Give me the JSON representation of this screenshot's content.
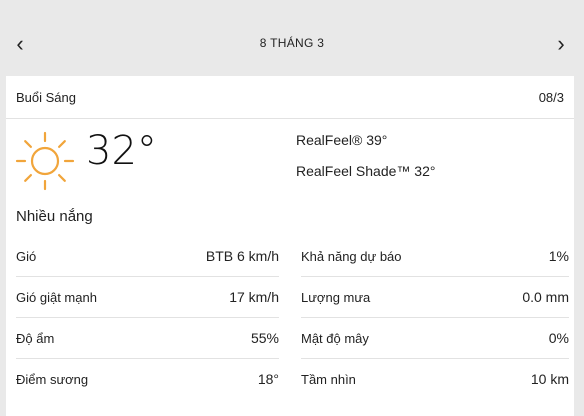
{
  "nav": {
    "prev_icon": "chevron-left-icon",
    "next_icon": "chevron-right-icon",
    "prev_glyph": "‹",
    "next_glyph": "›",
    "date_title": "8 THÁNG 3"
  },
  "card": {
    "period": "Buổi Sáng",
    "period_date": "08/3",
    "icon": "sun-icon",
    "icon_color": "#f1a53b",
    "temperature": "32°",
    "realfeel": "RealFeel® 39°",
    "realfeel_shade": "RealFeel Shade™ 32°",
    "phrase": "Nhiều nắng"
  },
  "details": {
    "left": [
      {
        "label": "Gió",
        "value": "BTB 6 km/h"
      },
      {
        "label": "Gió giật mạnh",
        "value": "17 km/h"
      },
      {
        "label": "Độ ẩm",
        "value": "55%"
      },
      {
        "label": "Điểm sương",
        "value": "18°"
      }
    ],
    "right": [
      {
        "label": "Khả năng dự báo",
        "value": "1%"
      },
      {
        "label": "Lượng mưa",
        "value": "0.0 mm"
      },
      {
        "label": "Mật độ mây",
        "value": "0%"
      },
      {
        "label": "Tầm nhìn",
        "value": "10 km"
      }
    ]
  }
}
